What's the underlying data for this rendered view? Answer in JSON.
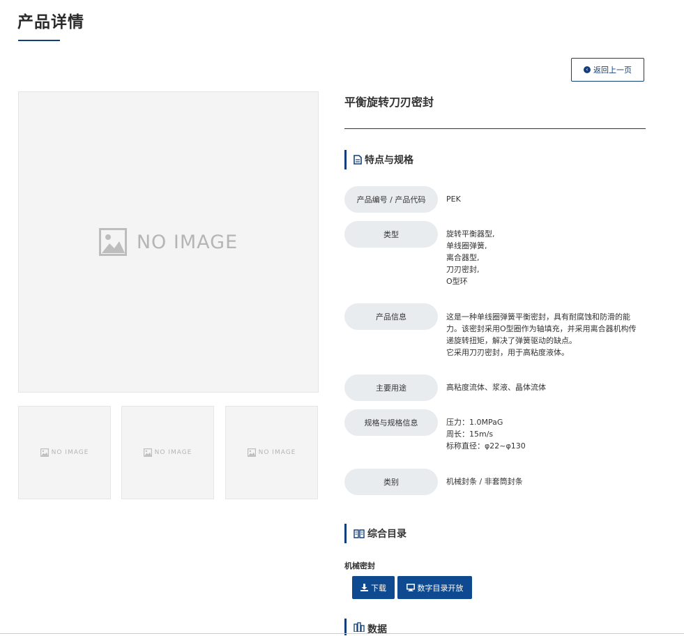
{
  "page": {
    "title": "产品详情"
  },
  "back_button": {
    "label": "返回上一页"
  },
  "images": {
    "main_placeholder": "NO IMAGE",
    "thumbnails": [
      "NO IMAGE",
      "NO IMAGE",
      "NO IMAGE"
    ]
  },
  "product": {
    "name": "平衡旋转刀刃密封"
  },
  "specs": {
    "heading": "特点与规格",
    "rows": [
      {
        "label": "产品编号 / 产品代码",
        "lines": [
          "PEK"
        ]
      },
      {
        "label": "类型",
        "lines": [
          "旋转平衡器型,",
          "单线圈弹簧,",
          "离合器型,",
          "刀刃密封,",
          "O型环"
        ]
      },
      {
        "label": "产品信息",
        "lines": [
          "这是一种单线圈弹簧平衡密封，具有耐腐蚀和防滑的能",
          "力。该密封采用O型圈作为轴填充，并采用离合器机构传",
          "递旋转扭矩，解决了弹簧驱动的缺点。",
          "它采用刀刃密封，用于高粘度液体。"
        ]
      },
      {
        "label": "主要用途",
        "lines": [
          "高粘度流体、浆液、晶体流体"
        ]
      },
      {
        "label": "规格与规格信息",
        "lines": [
          "压力：1.0MPaG",
          "周长：15m/s",
          "标称直径：φ22~φ130"
        ]
      },
      {
        "label": "类别",
        "lines": [
          "机械封条 / 非套筒封条"
        ]
      }
    ]
  },
  "catalog": {
    "heading": "综合目录",
    "label": "机械密封",
    "download_label": "下载",
    "digital_label": "数字目录开放"
  },
  "data_section": {
    "heading": "数据"
  },
  "colors": {
    "accent": "#123f7b",
    "button": "#0f4a90",
    "label_bg": "#e9ecef"
  }
}
